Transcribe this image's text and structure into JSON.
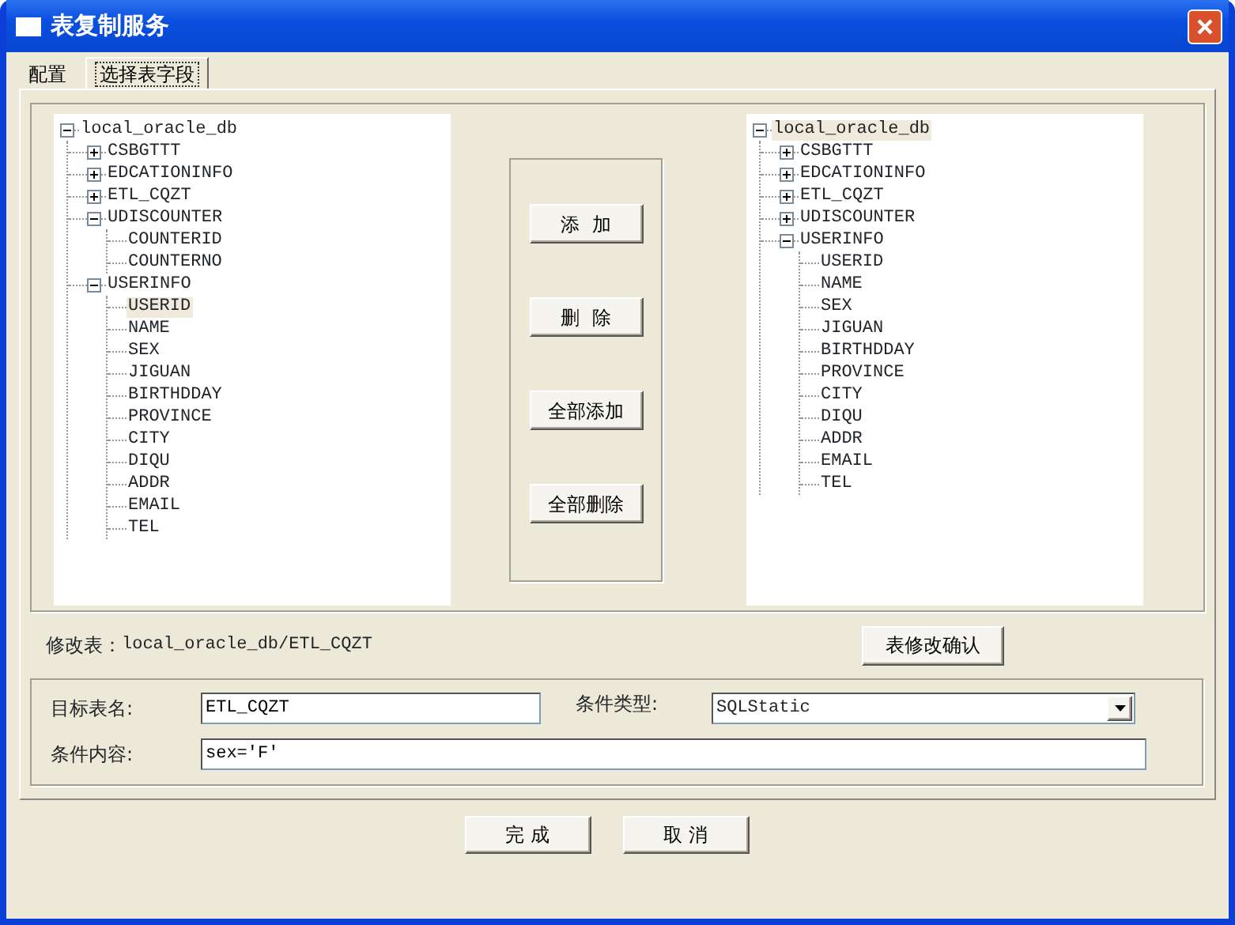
{
  "window": {
    "title": "表复制服务"
  },
  "tabs": [
    {
      "label": "配置",
      "selected": false
    },
    {
      "label": "选择表字段",
      "selected": true
    }
  ],
  "source_tree": [
    {
      "label": "local_oracle_db",
      "expanded": true,
      "selected": false,
      "children": [
        {
          "label": "CSBGTTT",
          "expanded": false,
          "selected": false
        },
        {
          "label": "EDCATIONINFO",
          "expanded": false,
          "selected": false
        },
        {
          "label": "ETL_CQZT",
          "expanded": false,
          "selected": false
        },
        {
          "label": "UDISCOUNTER",
          "expanded": true,
          "selected": false,
          "children": [
            {
              "label": "COUNTERID",
              "selected": false
            },
            {
              "label": "COUNTERNO",
              "selected": false
            }
          ]
        },
        {
          "label": "USERINFO",
          "expanded": true,
          "selected": false,
          "children": [
            {
              "label": "USERID",
              "selected": true
            },
            {
              "label": "NAME",
              "selected": false
            },
            {
              "label": "SEX",
              "selected": false
            },
            {
              "label": "JIGUAN",
              "selected": false
            },
            {
              "label": "BIRTHDDAY",
              "selected": false
            },
            {
              "label": "PROVINCE",
              "selected": false
            },
            {
              "label": "CITY",
              "selected": false
            },
            {
              "label": "DIQU",
              "selected": false
            },
            {
              "label": "ADDR",
              "selected": false
            },
            {
              "label": "EMAIL",
              "selected": false
            },
            {
              "label": "TEL",
              "selected": false
            }
          ]
        }
      ]
    }
  ],
  "move_buttons": [
    "添  加",
    "删  除",
    "全部添加",
    "全部删除"
  ],
  "target_tree": [
    {
      "label": "local_oracle_db",
      "expanded": true,
      "selected": true,
      "children": [
        {
          "label": "CSBGTTT",
          "expanded": false,
          "selected": false
        },
        {
          "label": "EDCATIONINFO",
          "expanded": false,
          "selected": false
        },
        {
          "label": "ETL_CQZT",
          "expanded": false,
          "selected": false
        },
        {
          "label": "UDISCOUNTER",
          "expanded": false,
          "selected": false
        },
        {
          "label": "USERINFO",
          "expanded": true,
          "selected": false,
          "children": [
            {
              "label": "USERID",
              "selected": false
            },
            {
              "label": "NAME",
              "selected": false
            },
            {
              "label": "SEX",
              "selected": false
            },
            {
              "label": "JIGUAN",
              "selected": false
            },
            {
              "label": "BIRTHDDAY",
              "selected": false
            },
            {
              "label": "PROVINCE",
              "selected": false
            },
            {
              "label": "CITY",
              "selected": false
            },
            {
              "label": "DIQU",
              "selected": false
            },
            {
              "label": "ADDR",
              "selected": false
            },
            {
              "label": "EMAIL",
              "selected": false
            },
            {
              "label": "TEL",
              "selected": false
            }
          ]
        }
      ]
    }
  ],
  "modified_table": {
    "label": "修改表：",
    "value": "local_oracle_db/ETL_CQZT"
  },
  "confirm_button": "表修改确认",
  "form": {
    "target_table_label": "目标表名:",
    "target_table_value": "ETL_CQZT",
    "condition_type_label": "条件类型:",
    "condition_type_value": "SQLStatic",
    "condition_content_label": "条件内容:",
    "condition_content_value": "sex='F'"
  },
  "footer_buttons": [
    "完 成",
    "取 消"
  ]
}
